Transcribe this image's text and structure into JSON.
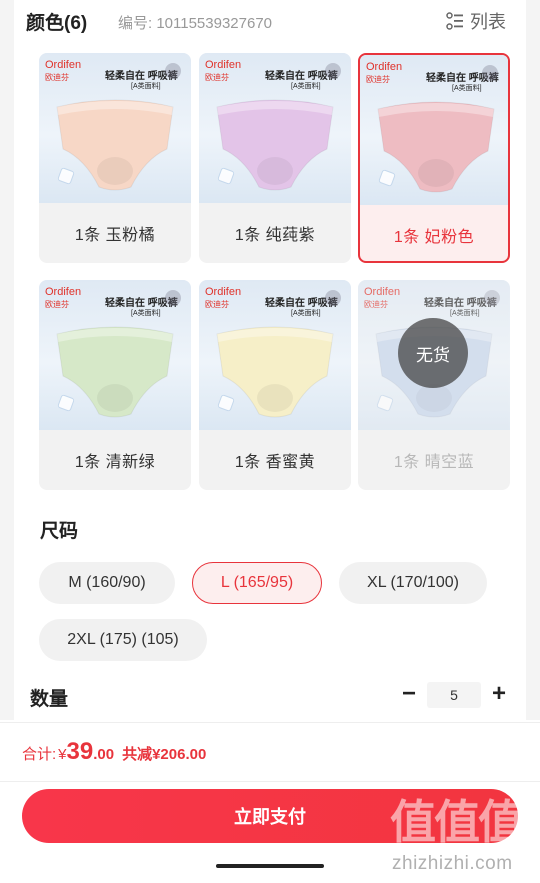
{
  "header": {
    "title": "颜色(6)",
    "code": "编号: 10115539327670",
    "list_label": "列表",
    "list_icon": "list-view-icon"
  },
  "product_card": {
    "brand": "Ordifen",
    "brand_sub": "欧迪芬",
    "slogan": "轻柔自在 呼吸裤",
    "slogan_sub": "[A类面料]"
  },
  "colors": [
    {
      "label": "1条 玉粉橘",
      "tint": "#f7d7c6",
      "state": "normal"
    },
    {
      "label": "1条 纯莼紫",
      "tint": "#e3c4e8",
      "state": "normal"
    },
    {
      "label": "1条 妃粉色",
      "tint": "#eebcc2",
      "state": "selected"
    },
    {
      "label": "1条 清新绿",
      "tint": "#d6e8c8",
      "state": "normal"
    },
    {
      "label": "1条 香蜜黄",
      "tint": "#f6efc8",
      "state": "normal"
    },
    {
      "label": "1条 晴空蓝",
      "tint": "#c7d6ec",
      "state": "disabled"
    }
  ],
  "sold_out_label": "无货",
  "size": {
    "title": "尺码",
    "options": [
      {
        "label": "M (160/90)",
        "selected": false
      },
      {
        "label": "L (165/95)",
        "selected": true
      },
      {
        "label": "XL (170/100)",
        "selected": false
      },
      {
        "label": "2XL (175) (105)",
        "selected": false
      }
    ]
  },
  "quantity": {
    "title": "数量",
    "value": "5",
    "minus": "−",
    "plus": "+"
  },
  "total": {
    "label": "合计:",
    "currency": "¥",
    "integer": "39",
    "decimal": ".00",
    "saved": "共减¥206.00"
  },
  "pay_button": "立即支付",
  "watermark": {
    "logo": "值值值",
    "url": "zhizhizhi.com"
  },
  "colors_theme": {
    "accent": "#e8343c"
  }
}
